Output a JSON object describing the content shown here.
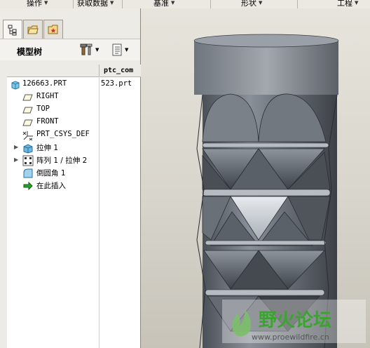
{
  "menubar": {
    "items": [
      {
        "label": "操作"
      },
      {
        "label": "获取数据"
      },
      {
        "label": "基准"
      },
      {
        "label": "形状"
      },
      {
        "label": "工程"
      }
    ]
  },
  "navigator": {
    "tabs": [
      {
        "icon": "model-tree-tab-icon"
      },
      {
        "icon": "folder-browser-tab-icon"
      },
      {
        "icon": "favorites-tab-icon"
      }
    ],
    "title": "模型树",
    "toolbar_icons": [
      "settings-tools-icon",
      "show-options-icon"
    ]
  },
  "tree": {
    "column_header": "ptc_com",
    "rows": [
      {
        "label": "126663.PRT",
        "value": "523.prt",
        "icon": "part-icon",
        "expandable": false,
        "indent": 0
      },
      {
        "label": "RIGHT",
        "value": "",
        "icon": "datum-plane-icon",
        "expandable": false,
        "indent": 1
      },
      {
        "label": "TOP",
        "value": "",
        "icon": "datum-plane-icon",
        "expandable": false,
        "indent": 1
      },
      {
        "label": "FRONT",
        "value": "",
        "icon": "datum-plane-icon",
        "expandable": false,
        "indent": 1
      },
      {
        "label": "PRT_CSYS_DEF",
        "value": "",
        "icon": "coordinate-system-icon",
        "expandable": false,
        "indent": 1
      },
      {
        "label": "拉伸 1",
        "value": "",
        "icon": "extrude-icon",
        "expandable": true,
        "indent": 1
      },
      {
        "label": "阵列 1 / 拉伸 2",
        "value": "",
        "icon": "pattern-icon",
        "expandable": true,
        "indent": 1
      },
      {
        "label": "倒圆角 1",
        "value": "",
        "icon": "round-icon",
        "expandable": false,
        "indent": 1
      },
      {
        "label": "在此插入",
        "value": "",
        "icon": "insert-here-arrow-icon",
        "expandable": false,
        "indent": 1
      }
    ]
  },
  "watermark": {
    "title": "野火论坛",
    "url": "www.proewildfire.cn"
  },
  "colors": {
    "panel_bg": "#ecebe6",
    "viewport_bg": "#ddd9d0",
    "model_shade": "#5a6068",
    "watermark_green": "#3aa52e"
  }
}
